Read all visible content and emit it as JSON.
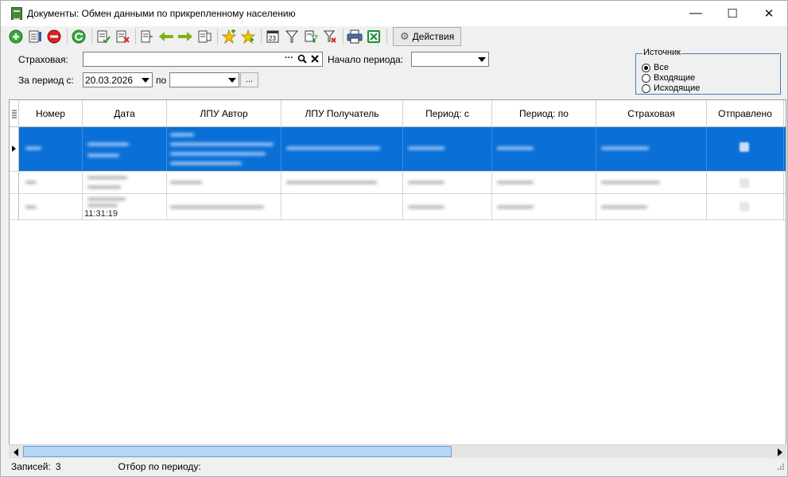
{
  "window": {
    "title": "Документы: Обмен данными по прикрепленному населению",
    "minimize": "—",
    "maximize": "☐",
    "close": "✕"
  },
  "toolbar": {
    "actions_label": "Действия"
  },
  "filters": {
    "insurer_label": "Страховая:",
    "insurer_value": "",
    "insurer_dots": "···",
    "period_start_label": "Начало периода:",
    "period_start_value": "",
    "period_from_label": "За период с:",
    "period_from_value": "20.03.2026",
    "period_to_label": "по",
    "period_to_value": "",
    "period_dots": "...",
    "source": {
      "legend": "Источник",
      "options": [
        "Все",
        "Входящие",
        "Исходящие"
      ],
      "selected": "Все"
    }
  },
  "table": {
    "columns": [
      "Номер",
      "Дата",
      "ЛПУ Автор",
      "ЛПУ Получатель",
      "Период: с",
      "Период: по",
      "Страховая",
      "Отправлено"
    ],
    "rows": [
      {
        "selected": true
      },
      {
        "selected": false
      },
      {
        "selected": false,
        "date_time": "11:31:19"
      }
    ]
  },
  "status": {
    "records_label": "Записей:",
    "records_count": "3",
    "period_filter_label": "Отбор по периоду:"
  }
}
